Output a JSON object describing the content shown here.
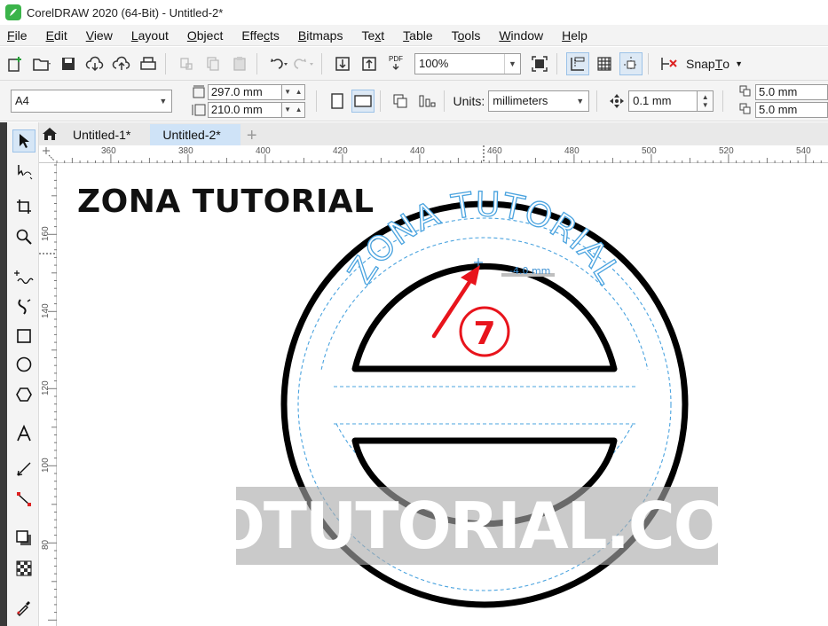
{
  "window": {
    "title": "CorelDRAW 2020 (64-Bit) - Untitled-2*"
  },
  "menu": [
    {
      "pre": "",
      "ul": "F",
      "post": "ile"
    },
    {
      "pre": "",
      "ul": "E",
      "post": "dit"
    },
    {
      "pre": "",
      "ul": "V",
      "post": "iew"
    },
    {
      "pre": "",
      "ul": "L",
      "post": "ayout"
    },
    {
      "pre": "",
      "ul": "O",
      "post": "bject"
    },
    {
      "pre": "Effe",
      "ul": "c",
      "post": "ts"
    },
    {
      "pre": "",
      "ul": "B",
      "post": "itmaps"
    },
    {
      "pre": "Te",
      "ul": "x",
      "post": "t"
    },
    {
      "pre": "",
      "ul": "T",
      "post": "able"
    },
    {
      "pre": "T",
      "ul": "o",
      "post": "ols"
    },
    {
      "pre": "",
      "ul": "W",
      "post": "indow"
    },
    {
      "pre": "",
      "ul": "H",
      "post": "elp"
    }
  ],
  "toolbar": {
    "zoom": "100%",
    "pdf_label": "PDF",
    "snap_pre": "Snap ",
    "snap_ul": "T",
    "snap_post": "o"
  },
  "property_bar": {
    "page_size": "A4",
    "width": "297.0 mm",
    "height": "210.0 mm",
    "units_label": "Units:",
    "units": "millimeters",
    "nudge": "0.1 mm",
    "dup_x": "5.0 mm",
    "dup_y": "5.0 mm"
  },
  "tabs": [
    {
      "label": "Untitled-1*",
      "active": false
    },
    {
      "label": "Untitled-2*",
      "active": true
    }
  ],
  "ruler": {
    "h": [
      "360",
      "380",
      "400",
      "420",
      "440",
      "460",
      "480",
      "500",
      "520",
      "540"
    ],
    "v": [
      "160",
      "140",
      "120",
      "100",
      "80"
    ]
  },
  "canvas": {
    "heading": "ZONA TUTORIAL",
    "arc_text": "ZONA TUTORIAL",
    "offset_readout": "-4.0 mm",
    "step_number": "7",
    "watermark": "ZOTUTORIAL.COM"
  },
  "colors": {
    "accent_blue": "#6aaee0",
    "annotation_red": "#e8141c",
    "black": "#000000"
  }
}
